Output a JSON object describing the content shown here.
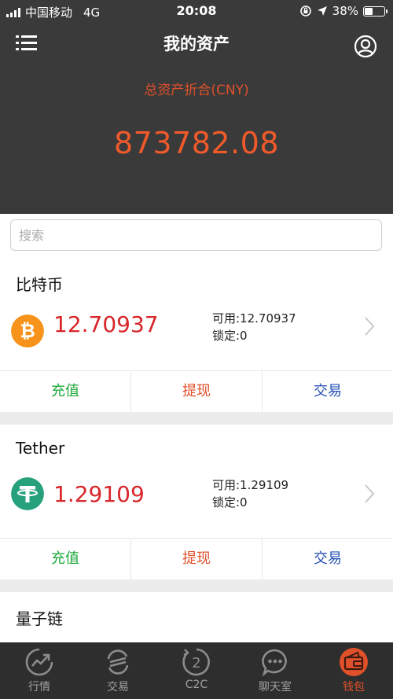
{
  "status_bar": {
    "carrier": "中国移动",
    "network": "4G",
    "time": "20:08",
    "battery": "38%"
  },
  "header": {
    "title": "我的资产",
    "total_label": "总资产折合(CNY)",
    "total_value": "873782.08"
  },
  "search": {
    "placeholder": "搜索",
    "value": ""
  },
  "assets": [
    {
      "name": "比特币",
      "icon": "bitcoin-icon",
      "color": "#f7931a",
      "amount": "12.70937",
      "available": "可用:12.70937",
      "locked": "锁定:0",
      "actions": [
        "充值",
        "提现",
        "交易"
      ]
    },
    {
      "name": "Tether",
      "icon": "tether-icon",
      "color": "#26a17b",
      "amount": "1.29109",
      "available": "可用:1.29109",
      "locked": "锁定:0",
      "actions": [
        "充值",
        "提现",
        "交易"
      ]
    },
    {
      "name": "量子链"
    }
  ],
  "tabs": [
    {
      "label": "行情",
      "icon": "market-trend-icon",
      "active": false
    },
    {
      "label": "交易",
      "icon": "exchange-icon",
      "active": false
    },
    {
      "label": "C2C",
      "icon": "c2c-icon",
      "active": false
    },
    {
      "label": "聊天室",
      "icon": "chat-bubble-icon",
      "active": false
    },
    {
      "label": "钱包",
      "icon": "wallet-icon",
      "active": true
    }
  ],
  "colors": {
    "accent": "#e0502a",
    "amount_red": "#d8262a",
    "deposit_green": "#1ea83a",
    "trade_blue": "#2550b4",
    "header_bg": "#3a3a3a",
    "tabbar_bg": "#2e2e2e"
  }
}
